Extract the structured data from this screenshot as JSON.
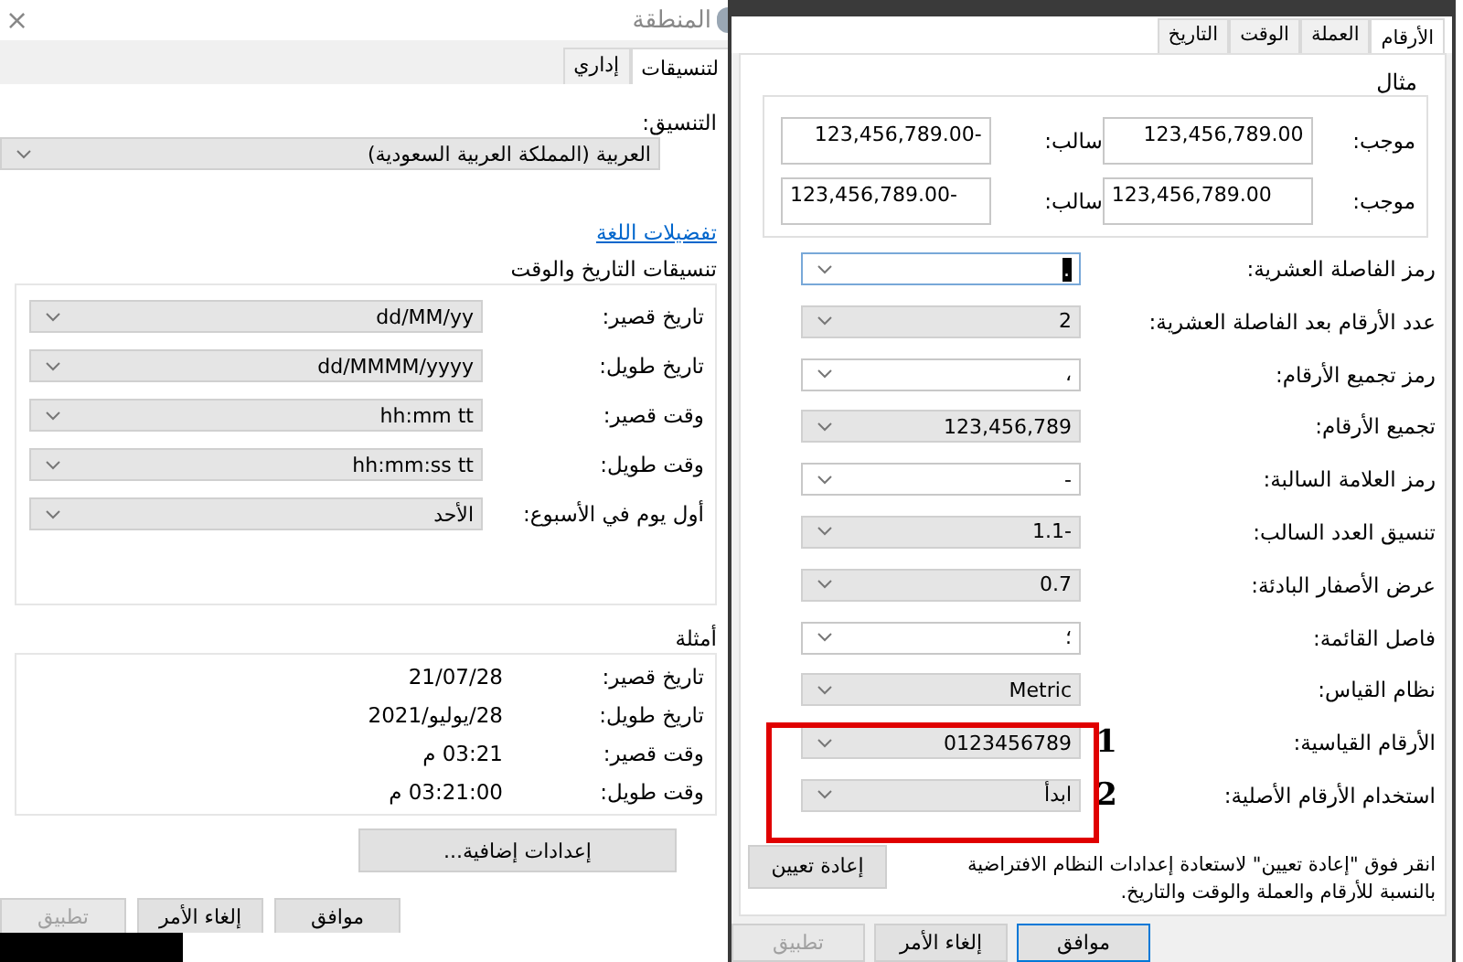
{
  "region_window": {
    "title": "المنطقة",
    "close_glyph": "×",
    "tabs": [
      {
        "label": "لتنسيقات",
        "selected": true
      },
      {
        "label": "إداري",
        "selected": false
      }
    ],
    "format_label": "التنسيق:",
    "format_value": "العربية (المملكة العربية السعودية)",
    "language_link": "تفضيلات اللغة",
    "date_time_group": {
      "title": "تنسيقات التاريخ والوقت",
      "rows": [
        {
          "label": "تاريخ قصير:",
          "value": "dd/MM/yy"
        },
        {
          "label": "تاريخ طويل:",
          "value": "dd/MMMM/yyyy"
        },
        {
          "label": "وقت قصير:",
          "value": "hh:mm tt"
        },
        {
          "label": "وقت طويل:",
          "value": "hh:mm:ss tt"
        },
        {
          "label": "أول يوم في الأسبوع:",
          "value": "الأحد"
        }
      ]
    },
    "examples_group": {
      "title": "أمثلة",
      "rows": [
        {
          "label": "تاريخ قصير:",
          "value": "21/07/28"
        },
        {
          "label": "تاريخ طويل:",
          "value": "28/يوليو/2021"
        },
        {
          "label": "وقت قصير:",
          "value": "03:21 م"
        },
        {
          "label": "وقت طويل:",
          "value": "03:21:00 م"
        }
      ]
    },
    "additional_button": "إعدادات إضافية...",
    "buttons": [
      {
        "label": "موافق",
        "disabled": false
      },
      {
        "label": "إلغاء الأمر",
        "disabled": false
      },
      {
        "label": "تطبيق",
        "disabled": true
      }
    ]
  },
  "customize_dialog": {
    "tabs": [
      {
        "label": "الأرقام",
        "selected": true
      },
      {
        "label": "العملة",
        "selected": false
      },
      {
        "label": "الوقت",
        "selected": false
      },
      {
        "label": "التاريخ",
        "selected": false
      }
    ],
    "example_group": {
      "title": "مثال",
      "rows": [
        {
          "positive_label": "موجب:",
          "positive": "123,456,789.00",
          "negative_label": "سالب:",
          "negative": "123,456,789.00-",
          "right_aligned": true
        },
        {
          "positive_label": "موجب:",
          "positive": "123,456,789.00",
          "negative_label": "سالب:",
          "negative": "123,456,789.00-",
          "right_aligned": false
        }
      ]
    },
    "settings": [
      {
        "label": "رمز الفاصلة العشرية:",
        "value": ".",
        "kind": "editable",
        "focused": true
      },
      {
        "label": "عدد الأرقام بعد الفاصلة العشرية:",
        "value": "2",
        "kind": "list",
        "focused": false
      },
      {
        "label": "رمز تجميع الأرقام:",
        "value": "،",
        "kind": "editable",
        "focused": false
      },
      {
        "label": "تجميع الأرقام:",
        "value": "123,456,789",
        "kind": "list",
        "focused": false
      },
      {
        "label": "رمز العلامة السالبة:",
        "value": "-",
        "kind": "editable",
        "focused": false
      },
      {
        "label": "تنسيق العدد السالب:",
        "value": "1.1-",
        "kind": "list",
        "focused": false
      },
      {
        "label": "عرض الأصفار البادئة:",
        "value": "0.7",
        "kind": "list",
        "focused": false
      },
      {
        "label": "فاصل القائمة:",
        "value": "؛",
        "kind": "editable",
        "focused": false
      },
      {
        "label": "نظام القياس:",
        "value": "Metric",
        "kind": "list",
        "focused": false
      },
      {
        "label": "الأرقام القياسية:",
        "value": "0123456789",
        "kind": "list",
        "focused": false,
        "annotation": "1"
      },
      {
        "label": "استخدام الأرقام الأصلية:",
        "value": "ابدأ",
        "kind": "list",
        "focused": false,
        "annotation": "2"
      }
    ],
    "reset_note": "انقر فوق \"إعادة تعيين\" لاستعادة إعدادات النظام الافتراضية بالنسبة للأرقام والعملة والوقت والتاريخ.",
    "reset_button": "إعادة تعيين",
    "buttons": [
      {
        "label": "موافق",
        "disabled": false
      },
      {
        "label": "إلغاء الأمر",
        "disabled": false
      },
      {
        "label": "تطبيق",
        "disabled": true
      }
    ]
  }
}
